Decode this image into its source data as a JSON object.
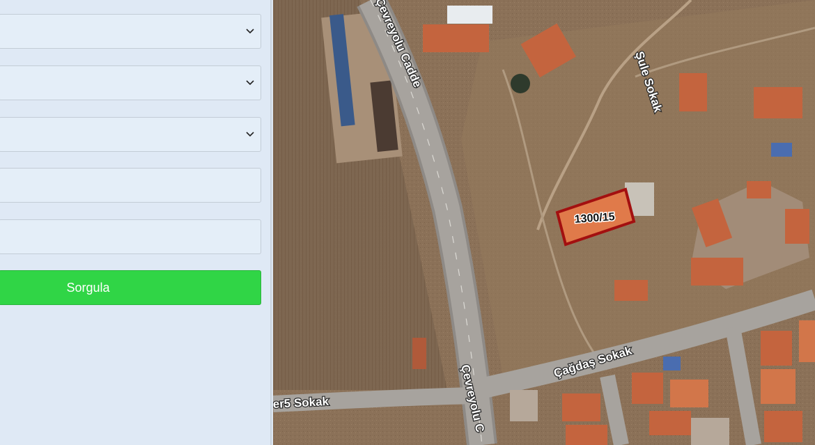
{
  "form": {
    "select_1_value": "",
    "select_2_value": "",
    "select_3_value": "",
    "input_1_value": "",
    "input_2_value": "",
    "submit_label": "Sorgula"
  },
  "map": {
    "parcel_label": "1300/15",
    "streets": {
      "cevreyolu_top": "Çevreyolu Cadde",
      "cevreyolu_bottom": "Çevreyolu C",
      "sule": "Şule Sokak",
      "cagdas": "Çağdaş Sokak",
      "er5": "er5 Sokak"
    },
    "colors": {
      "parcel_fill": "#e07a4a",
      "parcel_border": "#a31010",
      "submit_button": "#30d546"
    }
  }
}
